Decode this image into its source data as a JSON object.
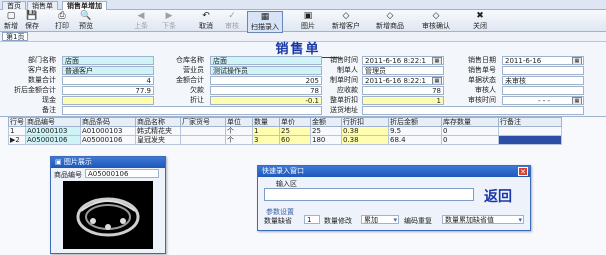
{
  "tabs": [
    "首页",
    "销售单",
    "销售单增加"
  ],
  "toolbar": {
    "buttons": [
      {
        "label": "新增",
        "icon": "new-icon",
        "disabled": false
      },
      {
        "label": "保存",
        "icon": "save-icon",
        "disabled": false
      },
      {
        "label": "打印",
        "icon": "print-icon",
        "disabled": false
      },
      {
        "label": "预览",
        "icon": "preview-icon",
        "disabled": false
      },
      {
        "label": "上条",
        "icon": "prev-icon",
        "disabled": true
      },
      {
        "label": "下条",
        "icon": "next-icon",
        "disabled": true
      },
      {
        "label": "取消",
        "icon": "cancel-icon",
        "disabled": false
      },
      {
        "label": "审核",
        "icon": "audit-icon",
        "disabled": true
      },
      {
        "label": "扫描录入",
        "icon": "scan-icon",
        "disabled": false
      },
      {
        "label": "图片",
        "icon": "image-icon",
        "disabled": false
      },
      {
        "label": "新增客户",
        "icon": "add-customer-icon",
        "disabled": false
      },
      {
        "label": "新增商品",
        "icon": "add-product-icon",
        "disabled": false
      },
      {
        "label": "审核确认",
        "icon": "audit-confirm-icon",
        "disabled": false
      },
      {
        "label": "关闭",
        "icon": "close-icon",
        "disabled": false
      }
    ]
  },
  "subtab": "第1页",
  "form": {
    "title": "销售单",
    "dept_label": "部门名称",
    "dept_value": "店面",
    "warehouse_label": "仓库名称",
    "warehouse_value": "店面",
    "sale_time_label": "销售时间",
    "sale_time_value": "2011-6-16 8:22:1",
    "sale_date_label": "销售日期",
    "sale_date_value": "2011-6-16",
    "customer_label": "客户名称",
    "customer_value": "普通客户",
    "salesperson_label": "营业员",
    "salesperson_value": "测试操作员",
    "maker_label": "制单人",
    "maker_value": "管理员",
    "order_no_label": "销售单号",
    "order_no_value": "",
    "qty_total_label": "数量合计",
    "qty_total_value": "4",
    "amount_total_label": "金额合计",
    "amount_total_value": "205",
    "make_time_label": "制单时间",
    "make_time_value": "2011-6-16 8:22:1",
    "status_label": "单据状态",
    "status_value": "未审核",
    "disc_total_label": "折后金额合计",
    "disc_total_value": "77.9",
    "owed_label": "欠款",
    "owed_value": "78",
    "received_label": "应收款",
    "received_value": "78",
    "auditor_label": "审核人",
    "auditor_value": "",
    "cash_label": "现金",
    "cash_value": "",
    "discount_label": "折让",
    "discount_value": "-0.1",
    "whole_disc_label": "整单折扣",
    "whole_disc_value": "1",
    "audit_time_label": "审核时间",
    "audit_time_value": "- - -",
    "remark_label": "备注",
    "remark_value": "",
    "ship_addr_label": "送货地址",
    "ship_addr_value": ""
  },
  "table": {
    "columns": [
      "行号",
      "商品编号",
      "商品条码",
      "商品名称",
      "厂家货号",
      "单位",
      "数量",
      "单价",
      "金额",
      "行折扣",
      "折后金额",
      "库存数量",
      "行备注"
    ],
    "rows": [
      [
        "1",
        "A01000103",
        "A01000103",
        "韩式精花夹",
        "",
        "个",
        "1",
        "25",
        "25",
        "0.38",
        "9.5",
        "0",
        ""
      ],
      [
        "2",
        "A05000106",
        "A05000106",
        "皇冠发夹",
        "",
        "个",
        "3",
        "60",
        "180",
        "0.38",
        "68.4",
        "0",
        ""
      ]
    ]
  },
  "image_window": {
    "title": "图片展示",
    "code_label": "商品编号",
    "code_value": "A05000106"
  },
  "quick_window": {
    "title": "快速录入窗口",
    "input_label": "输入区",
    "input_value": "",
    "back_label": "返回",
    "params_label": "参数设置",
    "default_qty_label": "数量缺省",
    "default_qty_value": "1",
    "qty_mode_label": "数量修改",
    "qty_mode_value": "累加",
    "code_dup_label": "编码重复",
    "code_dup_value": "数量累加缺省值"
  }
}
